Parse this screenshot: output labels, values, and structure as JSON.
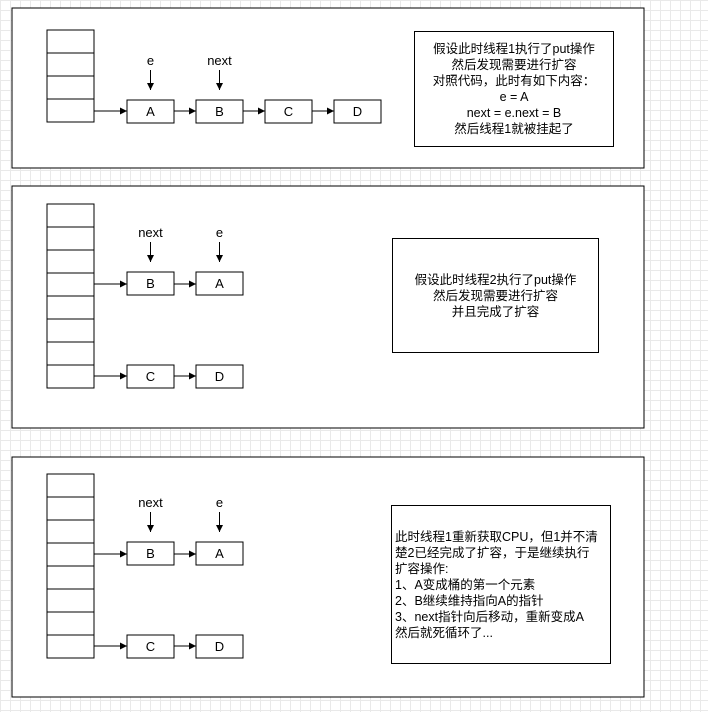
{
  "panels": [
    {
      "nodes": {
        "n1": "A",
        "n2": "B",
        "n3": "C",
        "n4": "D"
      },
      "pointers": {
        "p1": "e",
        "p2": "next"
      },
      "note": [
        "假设此时线程1执行了put操作",
        "然后发现需要进行扩容",
        "对照代码，此时有如下内容：",
        "e = A",
        "next = e.next = B",
        "然后线程1就被挂起了"
      ]
    },
    {
      "nodes": {
        "n1": "B",
        "n2": "A",
        "n3": "C",
        "n4": "D"
      },
      "pointers": {
        "p1": "next",
        "p2": "e"
      },
      "note": [
        "假设此时线程2执行了put操作",
        "然后发现需要进行扩容",
        "并且完成了扩容"
      ]
    },
    {
      "nodes": {
        "n1": "B",
        "n2": "A",
        "n3": "C",
        "n4": "D"
      },
      "pointers": {
        "p1": "next",
        "p2": "e"
      },
      "note": [
        "此时线程1重新获取CPU，但1并不清",
        "楚2已经完成了扩容，于是继续执行",
        "扩容操作:",
        "1、A变成桶的第一个元素",
        "2、B继续维持指向A的指针",
        "3、next指针向后移动，重新变成A",
        "然后就死循环了..."
      ]
    }
  ]
}
